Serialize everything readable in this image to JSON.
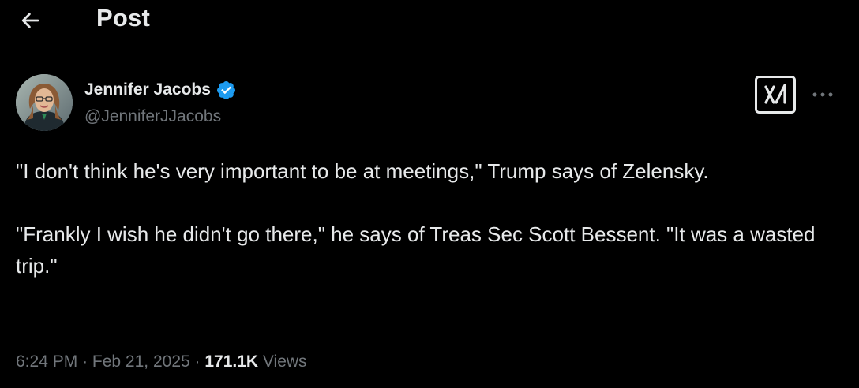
{
  "header": {
    "back_icon": "arrow-left-icon",
    "title": "Post"
  },
  "author": {
    "name": "Jennifer Jacobs",
    "handle": "@JenniferJJacobs",
    "verified": true,
    "verified_color": "#1d9bf0"
  },
  "actions": {
    "grok_icon": "grok-icon",
    "more_icon": "more-horizontal-icon"
  },
  "post": {
    "paragraphs": [
      "\"I don't think he's very important to be at meetings,\" Trump says of Zelensky.",
      "\"Frankly I wish he didn't go there,\" he says of Treas Sec Scott Bessent. \"It was a wasted trip.\""
    ]
  },
  "meta": {
    "time": "6:24 PM",
    "separator": "·",
    "date": "Feb 21, 2025",
    "views_count": "171.1K",
    "views_label": "Views"
  },
  "colors": {
    "background": "#000000",
    "primary_text": "#e7e9ea",
    "secondary_text": "#71767b"
  }
}
